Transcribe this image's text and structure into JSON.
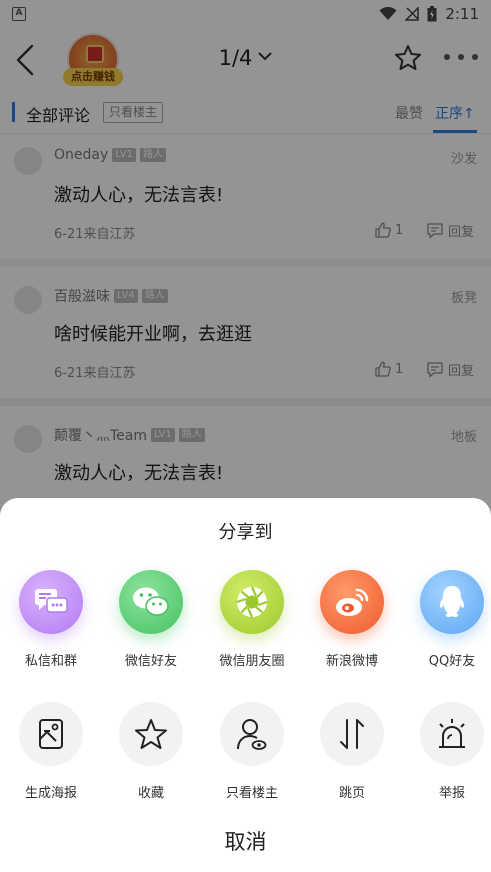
{
  "status": {
    "time": "2:11",
    "left_icon": "A"
  },
  "nav": {
    "coin_label": "点击赚钱",
    "page_indicator": "1/4"
  },
  "filter": {
    "title": "全部评论",
    "owner_only": "只看楼主",
    "sort_hot": "最赞",
    "sort_order": "正序↑"
  },
  "comments": [
    {
      "user": "Oneday",
      "level": "LV1",
      "role": "路人",
      "floor": "沙发",
      "text": "激动人心，无法言表!",
      "meta": "6-21来自江苏",
      "likes": "1",
      "reply": "回复"
    },
    {
      "user": "百般滋味",
      "level": "LV4",
      "role": "路人",
      "floor": "板凳",
      "text": "啥时候能开业啊，去逛逛",
      "meta": "6-21来自江苏",
      "likes": "1",
      "reply": "回复"
    },
    {
      "user": "颠覆丶灬Team",
      "level": "LV1",
      "role": "路人",
      "floor": "地板",
      "text": "激动人心，无法言表!",
      "meta": "",
      "likes": "",
      "reply": ""
    }
  ],
  "share_sheet": {
    "title": "分享到",
    "targets": [
      {
        "label": "私信和群",
        "icon": "message-group-icon",
        "color": "#c18bf5"
      },
      {
        "label": "微信好友",
        "icon": "wechat-icon",
        "color": "#5ccd74"
      },
      {
        "label": "微信朋友圈",
        "icon": "moments-icon",
        "color": "#a9d43c"
      },
      {
        "label": "新浪微博",
        "icon": "weibo-icon",
        "color": "#f06a3a"
      },
      {
        "label": "QQ好友",
        "icon": "qq-icon",
        "color": "#6eb4f7"
      }
    ],
    "actions": [
      {
        "label": "生成海报",
        "icon": "poster-icon"
      },
      {
        "label": "收藏",
        "icon": "star-icon"
      },
      {
        "label": "只看楼主",
        "icon": "owner-icon"
      },
      {
        "label": "跳页",
        "icon": "jump-page-icon"
      },
      {
        "label": "举报",
        "icon": "report-icon"
      }
    ],
    "cancel": "取消"
  }
}
